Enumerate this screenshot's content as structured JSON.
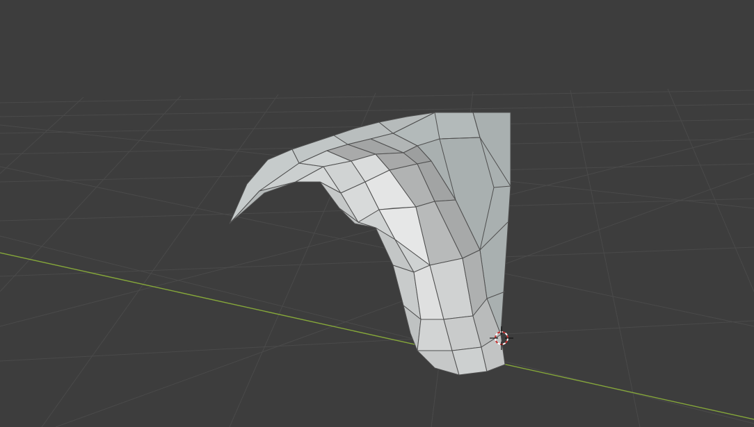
{
  "viewport": {
    "mode": "3d-viewport",
    "background_color": "#3d3d3d",
    "grid_color": "#4a4a4a",
    "x_axis_color": "#86a83a",
    "object": {
      "kind": "curved-mesh",
      "display": "solid-with-wireframe",
      "face_color_base": "#c9c9c9",
      "edge_color": "#4f4f4f"
    },
    "cursor": {
      "icon": "3d-cursor-icon",
      "ring_color_a": "#c83232",
      "ring_color_b": "#ffffff"
    }
  }
}
